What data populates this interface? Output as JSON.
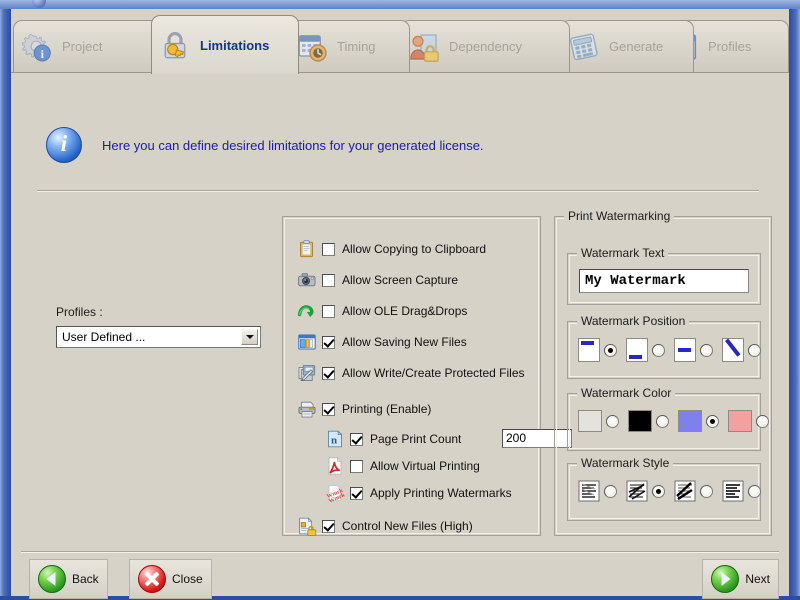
{
  "window": {
    "frame_color": "#2a4ba0"
  },
  "tabs": [
    {
      "label": "Project",
      "icon": "gear-info-icon",
      "active": false
    },
    {
      "label": "Limitations",
      "icon": "lock-key-icon",
      "active": true
    },
    {
      "label": "Timing",
      "icon": "calendar-clock-icon",
      "active": false
    },
    {
      "label": "Dependency",
      "icon": "user-lock-icon",
      "active": false
    },
    {
      "label": "Generate",
      "icon": "calculator-icon",
      "active": false
    },
    {
      "label": "Profiles",
      "icon": "list-window-icon",
      "active": false
    }
  ],
  "info": {
    "icon": "info-icon",
    "text": "Here you can define desired limitations for your generated license.",
    "text_color": "#1a1ab4"
  },
  "profiles": {
    "label": "Profiles :",
    "selected": "User Defined ...",
    "options": [
      "User Defined ..."
    ]
  },
  "limitations": [
    {
      "label": "Allow Copying to Clipboard",
      "checked": false,
      "icon": "clipboard-icon",
      "indent": false
    },
    {
      "label": "Allow Screen Capture",
      "checked": false,
      "icon": "camera-icon",
      "indent": false
    },
    {
      "label": "Allow OLE Drag&Drops",
      "checked": false,
      "icon": "arrow-swirl-icon",
      "indent": false
    },
    {
      "label": "Allow Saving New Files",
      "checked": true,
      "icon": "save-window-icon",
      "indent": false
    },
    {
      "label": "Allow Write/Create Protected Files",
      "checked": true,
      "icon": "write-files-icon",
      "indent": false
    },
    {
      "label": "Printing (Enable)",
      "checked": true,
      "icon": "printer-icon",
      "indent": false
    },
    {
      "label": "Page Print Count",
      "checked": true,
      "icon": "page-number-icon",
      "indent": true
    },
    {
      "label": "Allow Virtual Printing",
      "checked": false,
      "icon": "pdf-icon",
      "indent": true
    },
    {
      "label": "Apply Printing Watermarks",
      "checked": true,
      "icon": "watermark-page-icon",
      "indent": true
    },
    {
      "label": "Control New Files (High)",
      "checked": true,
      "icon": "file-lock-icon",
      "indent": false
    }
  ],
  "page_print_count": {
    "value": "200",
    "placeholder": ""
  },
  "watermark": {
    "group_title": "Print Watermarking",
    "text_group_title": "Watermark Text",
    "text_value": "My Watermark",
    "position_group_title": "Watermark Position",
    "positions": [
      {
        "name": "top",
        "selected": true
      },
      {
        "name": "bottom",
        "selected": false
      },
      {
        "name": "middle",
        "selected": false
      },
      {
        "name": "diagonal",
        "selected": false
      }
    ],
    "color_group_title": "Watermark Color",
    "colors": [
      {
        "name": "light-gray",
        "hex": "#e4e2dc",
        "selected": false
      },
      {
        "name": "black",
        "hex": "#000000",
        "selected": false
      },
      {
        "name": "blue",
        "hex": "#8080ea",
        "selected": true
      },
      {
        "name": "pink",
        "hex": "#f5a0a0",
        "selected": false
      }
    ],
    "style_group_title": "Watermark Style",
    "styles": [
      {
        "name": "behind-text",
        "selected": false
      },
      {
        "name": "over-text",
        "selected": true
      },
      {
        "name": "dense-overlay",
        "selected": false
      },
      {
        "name": "light-overlay",
        "selected": false
      }
    ]
  },
  "footer": {
    "back_label": "Back",
    "close_label": "Close",
    "next_label": "Next"
  }
}
